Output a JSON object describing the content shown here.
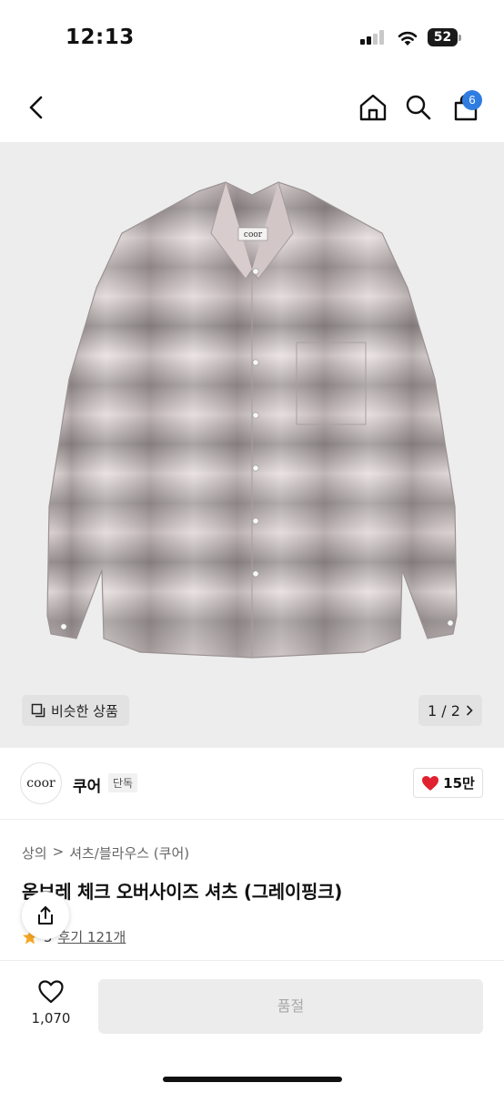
{
  "status_bar": {
    "time": "12:13",
    "battery": "52"
  },
  "header": {
    "cart_count": "6"
  },
  "image": {
    "brand_tag": "coor",
    "similar_label": "비슷한 상품",
    "page_indicator": "1 / 2"
  },
  "brand": {
    "logo_text": "coor",
    "name": "쿠어",
    "badge": "단독",
    "likes": "15만"
  },
  "product": {
    "breadcrumb": [
      "상의",
      ">",
      "셔츠/블라우스 (쿠어)"
    ],
    "title": "옴브레 체크 오버사이즈 셔츠 (그레이핑크)",
    "rating_partial": "5",
    "reviews": "후기 121개"
  },
  "bottom": {
    "wish_count": "1,070",
    "soldout_label": "품절"
  },
  "colors": {
    "accent": "#2f7de1",
    "heart": "#e0212f",
    "star": "#f5a623"
  }
}
